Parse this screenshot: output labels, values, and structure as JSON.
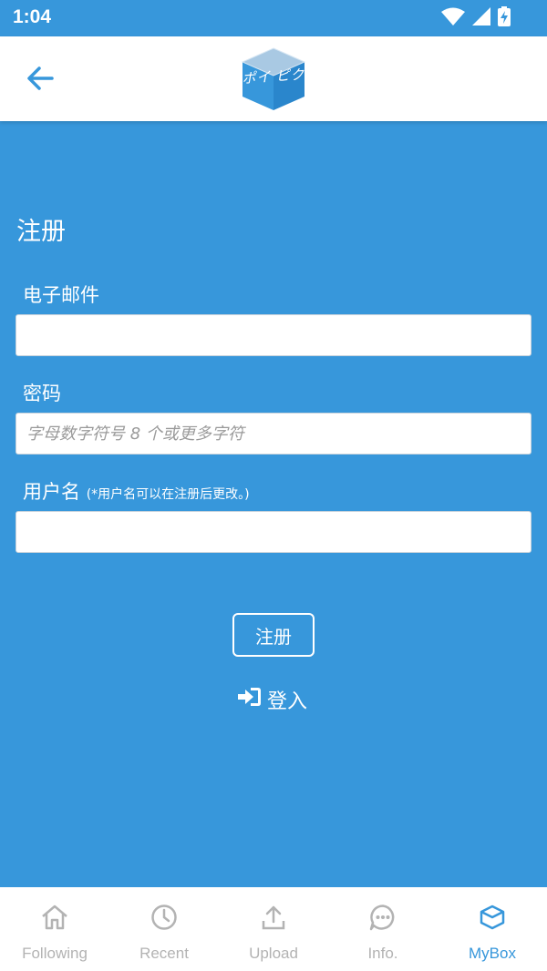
{
  "status_bar": {
    "time": "1:04"
  },
  "logo": {
    "text": "ポイ ピク"
  },
  "form": {
    "title": "注册",
    "email_label": "电子邮件",
    "email_value": "",
    "password_label": "密码",
    "password_placeholder": "字母数字符号 8 个或更多字符",
    "username_label": "用户名",
    "username_hint": "(*用户名可以在注册后更改。)",
    "username_value": "",
    "submit_label": "注册",
    "login_label": "登入"
  },
  "tabs": [
    {
      "label": "Following",
      "icon": "home-icon"
    },
    {
      "label": "Recent",
      "icon": "clock-icon"
    },
    {
      "label": "Upload",
      "icon": "upload-icon"
    },
    {
      "label": "Info.",
      "icon": "chat-icon"
    },
    {
      "label": "MyBox",
      "icon": "box-icon",
      "active": true
    }
  ],
  "colors": {
    "primary": "#3797db",
    "tab_inactive": "#b3b3b3",
    "white": "#ffffff"
  }
}
